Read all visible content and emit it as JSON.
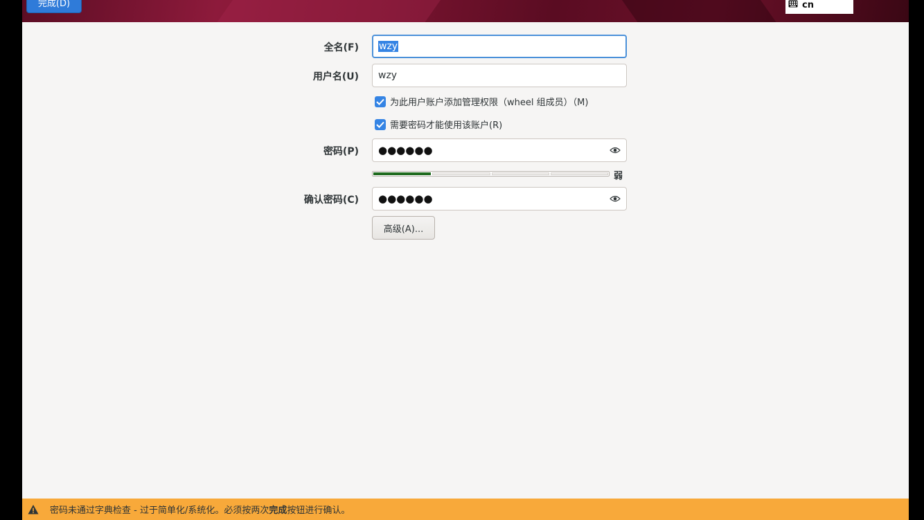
{
  "header": {
    "done_label": "完成(D)",
    "keyboard_layout": "cn"
  },
  "form": {
    "fullname_label": "全名(F)",
    "fullname_value": "wzy",
    "username_label": "用户名(U)",
    "username_value": "wzy",
    "admin_checkbox_label": "为此用户账户添加管理权限（wheel 组成员）（M)",
    "admin_checked": true,
    "require_password_label": "需要密码才能使用该账户(R)",
    "require_password_checked": true,
    "password_label": "密码(P)",
    "password_mask": "●●●●●●",
    "strength_label": "弱",
    "strength_level": 0.25,
    "confirm_label": "确认密码(C)",
    "confirm_mask": "●●●●●●",
    "advanced_label": "高级(A)..."
  },
  "warning": {
    "text_before": "密码未通过字典检查 - 过于简单化/系统化。必须按两次",
    "text_bold": "完成",
    "text_after": "按钮进行确认。"
  },
  "colors": {
    "accent": "#3584e4",
    "warning_bg": "#f8a93a",
    "strength_fill": "#1e6a1e"
  }
}
